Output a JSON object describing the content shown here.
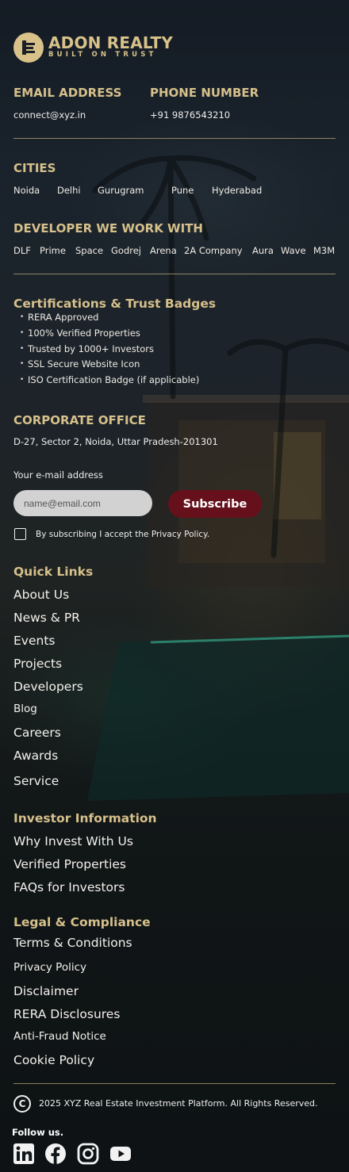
{
  "brand": {
    "name": "ADON REALTY",
    "tagline": "BUILT ON TRUST"
  },
  "contact": {
    "email_heading": "EMAIL ADDRESS",
    "email": "connect@xyz.in",
    "phone_heading": "PHONE NUMBER",
    "phone": "+91 9876543210"
  },
  "cities": {
    "heading": "CITIES",
    "items": [
      "Noida",
      "Delhi",
      "Gurugram",
      "Pune",
      "Hyderabad"
    ]
  },
  "developers": {
    "heading": "DEVELOPER WE WORK WITH",
    "items": [
      "DLF",
      "Prime",
      "Space",
      "Godrej",
      "Arena",
      "2A Company",
      "Aura",
      "Wave",
      "M3M"
    ]
  },
  "certifications": {
    "heading": "Certifications & Trust Badges",
    "items": [
      "RERA Approved",
      "100% Verified Properties",
      "Trusted by 1000+ Investors",
      "SSL Secure Website Icon",
      "ISO Certification Badge (if applicable)"
    ]
  },
  "office": {
    "heading": "CORPORATE OFFICE",
    "address": "D-27, Sector 2, Noida, Uttar Pradesh-201301"
  },
  "newsletter": {
    "label": "Your e-mail address",
    "placeholder": "name@email.com",
    "button": "Subscribe",
    "consent": "By subscribing I accept the Privacy Policy."
  },
  "quick_links": {
    "heading": "Quick Links",
    "items": [
      "About Us",
      "News & PR",
      "Events",
      "Projects",
      "Developers",
      "Blog",
      "Careers",
      "Awards",
      "Service"
    ]
  },
  "investor": {
    "heading": "Investor Information",
    "items": [
      "Why Invest With Us",
      "Verified Properties",
      "FAQs for Investors"
    ]
  },
  "legal": {
    "heading": "Legal & Compliance",
    "items": [
      "Terms & Conditions",
      "Privacy Policy",
      "Disclaimer",
      "RERA Disclosures",
      "Anti-Fraud Notice",
      "Cookie Policy"
    ]
  },
  "footer": {
    "copyright": "2025 XYZ Real Estate Investment Platform. All Rights Reserved.",
    "follow": "Follow us.",
    "social": [
      "linkedin-icon",
      "facebook-icon",
      "instagram-icon",
      "youtube-icon"
    ]
  },
  "colors": {
    "gold": "#d6c08b",
    "subscribe": "#66101c",
    "background": "#161c22"
  }
}
